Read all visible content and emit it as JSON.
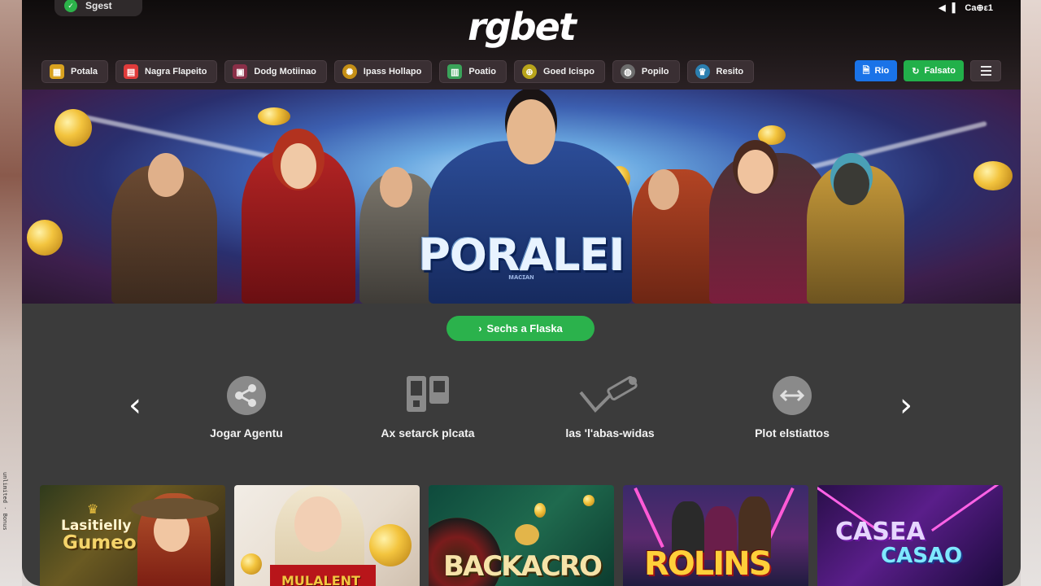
{
  "status": {
    "left_label": "Sgest",
    "right_label": "Ca⊕ε1"
  },
  "brand": {
    "logo": "rgbet"
  },
  "nav": {
    "items": [
      {
        "label": "Potala",
        "icon": "slot-icon",
        "color": "#d9a21f"
      },
      {
        "label": "Nagra Flapeito",
        "icon": "cards-icon",
        "color": "#e03b3b"
      },
      {
        "label": "Dodg Motiinao",
        "icon": "screen-icon",
        "color": "#8a2f48"
      },
      {
        "label": "Ipass Hollapo",
        "icon": "sun-icon",
        "color": "#c58f16"
      },
      {
        "label": "Poatio",
        "icon": "chips-icon",
        "color": "#3aa35a"
      },
      {
        "label": "Goed Icispo",
        "icon": "ball-icon",
        "color": "#b8a41b"
      },
      {
        "label": "Popilo",
        "icon": "globe-icon",
        "color": "#6d6d6d"
      },
      {
        "label": "Resito",
        "icon": "trophy-icon",
        "color": "#2b7fb0"
      }
    ],
    "actions": {
      "register": "Rio",
      "login": "Falsato"
    }
  },
  "hero": {
    "title": "PORALEI",
    "subtitle": "ᴍᴀᴄɪᴀɴ"
  },
  "cta": {
    "label": "Sechs a Flaska"
  },
  "features": [
    {
      "label": "Jogar Agentu",
      "icon": "share-icon"
    },
    {
      "label": "Ax setarck plcata",
      "icon": "devices-icon"
    },
    {
      "label": "las 'l'abas-widas",
      "icon": "tools-icon"
    },
    {
      "label": "Plot elstiattos",
      "icon": "swap-icon"
    }
  ],
  "games": [
    {
      "title_line1": "Lasitielly",
      "title_line2": "Gumeo"
    },
    {
      "title_line1": "MULALENT",
      "title_line2": ""
    },
    {
      "title_line1": "BACKACRO",
      "title_line2": ""
    },
    {
      "title_line1": "ROLINS",
      "title_line2": ""
    },
    {
      "title_line1": "CASEA",
      "title_line2": "CASAO"
    }
  ],
  "side_text": "unlimited · Bonus",
  "colors": {
    "accent_green": "#2bb24c",
    "accent_blue": "#1a73e8",
    "frame": "#3b3b3b"
  }
}
